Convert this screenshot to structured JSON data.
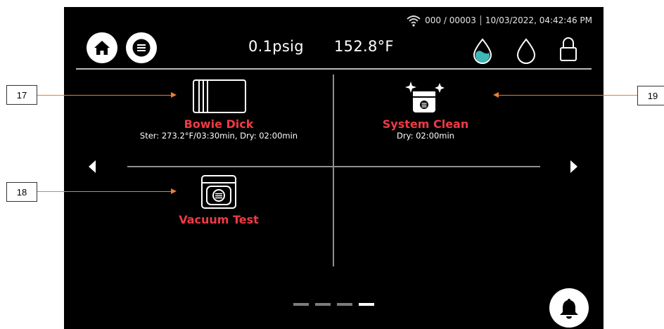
{
  "status": {
    "cycle_counter": "000 / 00003",
    "datetime": "10/03/2022, 04:42:46 PM"
  },
  "readings": {
    "pressure": "0.1psig",
    "temperature": "152.8°F"
  },
  "cycles": [
    {
      "name": "Bowie Dick",
      "detail": "Ster: 273.2°F/03:30min, Dry: 02:00min",
      "icon": "bowie-dick-pack-icon"
    },
    {
      "name": "System Clean",
      "detail": "Dry: 02:00min",
      "icon": "system-clean-sparkle-icon"
    },
    {
      "name": "Vacuum Test",
      "detail": "",
      "icon": "vacuum-chamber-icon"
    }
  ],
  "callouts": [
    "17",
    "18",
    "19"
  ],
  "pagination": {
    "total": 4,
    "current": 4
  },
  "colors": {
    "accent_red": "#ee3b45",
    "water_fill": "#3fb6b8",
    "callout_line": "#ed7d31"
  },
  "icons": [
    "home-icon",
    "menu-icon",
    "wifi-icon",
    "water-full-icon",
    "water-empty-icon",
    "lock-icon",
    "bell-icon",
    "chevron-left-icon",
    "chevron-right-icon"
  ]
}
